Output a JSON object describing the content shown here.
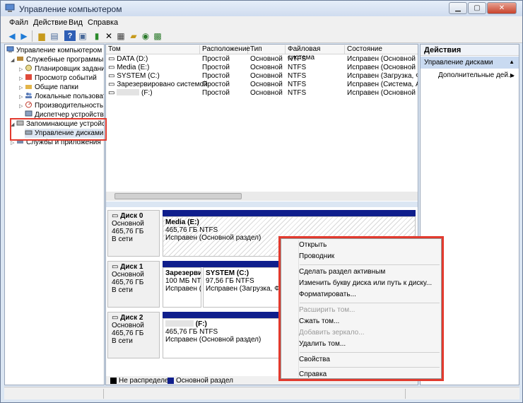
{
  "window": {
    "title": "Управление компьютером"
  },
  "menu": [
    "Файл",
    "Действие",
    "Вид",
    "Справка"
  ],
  "toolbar_icons": [
    "back-arrow-icon",
    "forward-arrow-icon",
    "up-folder-icon",
    "show-hide-tree-icon",
    "help-icon",
    "console-icon",
    "export-list-icon",
    "delete-icon",
    "properties-icon",
    "open-folder-icon",
    "search-disk-icon",
    "disk-settings-icon"
  ],
  "tree": {
    "root": "Управление компьютером (л",
    "utilities": "Служебные программы",
    "scheduler": "Планировщик заданий",
    "event_viewer": "Просмотр событий",
    "shared_folders": "Общие папки",
    "local_users": "Локальные пользовате",
    "performance": "Производительность",
    "device_manager": "Диспетчер устройств",
    "storage": "Запоминающие устройст",
    "disk_management": "Управление дисками",
    "services": "Службы и приложения"
  },
  "volume_table": {
    "columns": [
      "Том",
      "Расположение",
      "Тип",
      "Файловая система",
      "Состояние"
    ],
    "rows": [
      {
        "name": "DATA (D:)",
        "layout": "Простой",
        "type": "Основной",
        "fs": "NTFS",
        "status": "Исправен (Основной раздел"
      },
      {
        "name": "Media (E:)",
        "layout": "Простой",
        "type": "Основной",
        "fs": "NTFS",
        "status": "Исправен (Основной раздел"
      },
      {
        "name": "SYSTEM (C:)",
        "layout": "Простой",
        "type": "Основной",
        "fs": "NTFS",
        "status": "Исправен (Загрузка, Фай"
      },
      {
        "name": "Зарезервировано системой",
        "layout": "Простой",
        "type": "Основной",
        "fs": "NTFS",
        "status": "Исправен (Система, Акти"
      },
      {
        "name": "(F:)",
        "layout": "Простой",
        "type": "Основной",
        "fs": "NTFS",
        "status": "Исправен (Основной раздел"
      }
    ]
  },
  "disks": [
    {
      "name": "Диск 0",
      "kind": "Основной",
      "size": "465,76 ГБ",
      "state": "В сети",
      "partitions": [
        {
          "name": "Media  (E:)",
          "size": "465,76 ГБ NTFS",
          "status": "Исправен (Основной раздел)"
        }
      ]
    },
    {
      "name": "Диск 1",
      "kind": "Основной",
      "size": "465,76 ГБ",
      "state": "В сети",
      "partitions": [
        {
          "name": "Зарезерви",
          "size": "100 МБ NTF",
          "status": "Исправен ("
        },
        {
          "name": "SYSTEM  (C:)",
          "size": "97,56 ГБ NTFS",
          "status": "Исправен (Загрузка, Фай"
        }
      ]
    },
    {
      "name": "Диск 2",
      "kind": "Основной",
      "size": "465,76 ГБ",
      "state": "В сети",
      "partitions": [
        {
          "name": "(F:)",
          "size": "465,76 ГБ NTFS",
          "status": "Исправен (Основной раздел)"
        }
      ]
    }
  ],
  "legend": {
    "unallocated": "Не распределен",
    "primary": "Основной раздел"
  },
  "actions": {
    "title": "Действия",
    "section": "Управление дисками",
    "more": "Дополнительные дей..."
  },
  "context_menu": {
    "open": "Открыть",
    "explorer": "Проводник",
    "mark_active": "Сделать раздел активным",
    "change_letter": "Изменить букву диска или путь к диску...",
    "format": "Форматировать...",
    "extend": "Расширить том...",
    "shrink": "Сжать том...",
    "add_mirror": "Добавить зеркало...",
    "delete": "Удалить том...",
    "properties": "Свойства",
    "help": "Справка"
  },
  "colors": {
    "primary_partition": "#0f1e8c",
    "unallocated": "#000000",
    "highlight": "#e23a2e",
    "selection": "#c9daf1"
  }
}
